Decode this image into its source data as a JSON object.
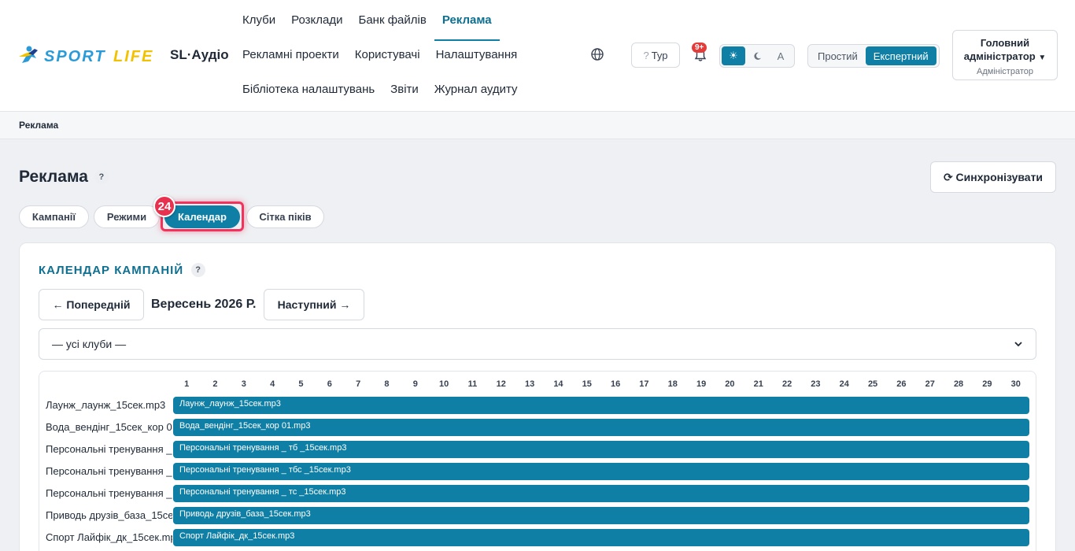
{
  "header": {
    "brand": "SL·Аудіо",
    "logo_alt": "SPORT LIFE",
    "nav_rows": [
      [
        {
          "label": "Клуби",
          "active": false
        },
        {
          "label": "Розклади",
          "active": false
        },
        {
          "label": "Банк файлів",
          "active": false
        },
        {
          "label": "Реклама",
          "active": true
        }
      ],
      [
        {
          "label": "Рекламні проекти",
          "active": false
        },
        {
          "label": "Користувачі",
          "active": false
        },
        {
          "label": "Налаштування",
          "active": false
        }
      ],
      [
        {
          "label": "Бібліотека налаштувань",
          "active": false
        },
        {
          "label": "Звіти",
          "active": false
        },
        {
          "label": "Журнал аудиту",
          "active": false
        }
      ]
    ],
    "tour_label": "Тур",
    "notifications_badge": "9+",
    "theme_options": [
      {
        "label": "☀",
        "active": true
      },
      {
        "label": "",
        "active": false
      },
      {
        "label": "A",
        "active": false
      }
    ],
    "mode_options": [
      {
        "label": "Простий",
        "active": false
      },
      {
        "label": "Експертний",
        "active": true
      }
    ],
    "user": {
      "name": "Головний адміністратор",
      "role": "Адміністратор"
    }
  },
  "breadcrumb": "Реклама",
  "page": {
    "title": "Реклама",
    "help": "?",
    "sync_label": "⟳ Синхронізувати",
    "step_badge": "24",
    "tabs": [
      {
        "label": "Кампанії",
        "active": false
      },
      {
        "label": "Режими",
        "active": false
      },
      {
        "label": "Календар",
        "active": true
      },
      {
        "label": "Сітка піків",
        "active": false
      }
    ]
  },
  "calendar": {
    "title": "КАЛЕНДАР КАМПАНІЙ",
    "help": "?",
    "prev_label": "← Попередній",
    "month": "Вересень 2026 Р.",
    "next_label": "Наступний →",
    "club_filter": "— усі клуби —",
    "days": [
      "1",
      "2",
      "3",
      "4",
      "5",
      "6",
      "7",
      "8",
      "9",
      "10",
      "11",
      "12",
      "13",
      "14",
      "15",
      "16",
      "17",
      "18",
      "19",
      "20",
      "21",
      "22",
      "23",
      "24",
      "25",
      "26",
      "27",
      "28",
      "29",
      "30"
    ],
    "rows": [
      {
        "label": "Лаунж_лаунж_15сек.mp3",
        "bar": "Лаунж_лаунж_15сек.mp3"
      },
      {
        "label": "Вода_вендінг_15сек_кор 01.mp3",
        "bar": "Вода_вендінг_15сек_кор 01.mp3"
      },
      {
        "label": "Персональні тренування _ тб _15сек.mp3",
        "bar": "Персональні тренування _ тб _15сек.mp3"
      },
      {
        "label": "Персональні тренування _ тбс _15сек.mp3",
        "bar": "Персональні тренування _ тбс _15сек.mp3"
      },
      {
        "label": "Персональні тренування _ тс _15сек.mp3",
        "bar": "Персональні тренування _ тс _15сек.mp3"
      },
      {
        "label": "Приводь друзів_база_15сек.mp3",
        "bar": "Приводь друзів_база_15сек.mp3"
      },
      {
        "label": "Спорт Лайфік_дк_15сек.mp3",
        "bar": "Спорт Лайфік_дк_15сек.mp3"
      }
    ]
  },
  "colors": {
    "accent": "#0f7fa5",
    "highlight": "#f2325a",
    "badge": "#e43b3b"
  }
}
